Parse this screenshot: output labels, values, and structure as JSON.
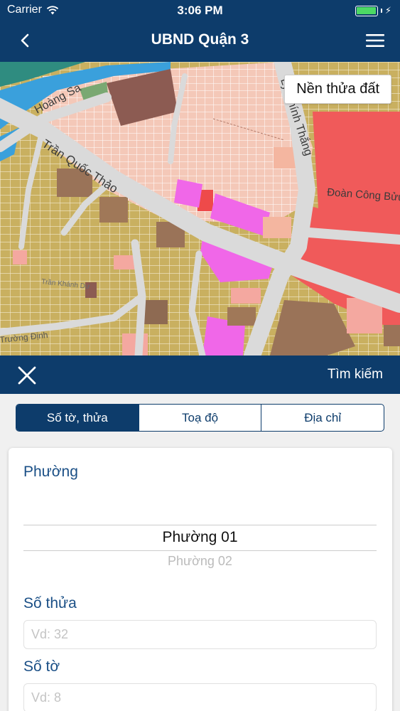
{
  "status_bar": {
    "carrier": "Carrier",
    "time": "3:06 PM",
    "battery_level": 1.0
  },
  "nav": {
    "title": "UBND Quận 3",
    "back_icon": "chevron-left-icon",
    "menu_icon": "hamburger-menu-icon"
  },
  "map": {
    "layer_button": "Nền thửa đất",
    "street_labels": [
      "Hoàng Sa",
      "Trần Quốc Thảo",
      "Lý Chính Thắng",
      "Đoàn Công Bửu",
      "Trần Khánh Dư",
      "Trường Định"
    ]
  },
  "search_bar": {
    "close_icon": "close-icon",
    "search_label": "Tìm kiếm"
  },
  "tabs": [
    {
      "label": "Số tờ, thửa",
      "active": true
    },
    {
      "label": "Toạ độ",
      "active": false
    },
    {
      "label": "Địa chỉ",
      "active": false
    }
  ],
  "form": {
    "ward_label": "Phường",
    "ward_selected": "Phường 01",
    "ward_next": "Phường 02",
    "parcel_label": "Số thửa",
    "parcel_placeholder": "Vd: 32",
    "sheet_label": "Số tờ",
    "sheet_placeholder": "Vd: 8"
  },
  "colors": {
    "primary": "#0d3c6b",
    "label_blue": "#1a4f86",
    "map_residential": "#c9b060",
    "map_commercial": "#f05a5a",
    "map_public": "#f067e8",
    "map_road": "#d9d9d9",
    "map_water": "#3aa0dc"
  }
}
